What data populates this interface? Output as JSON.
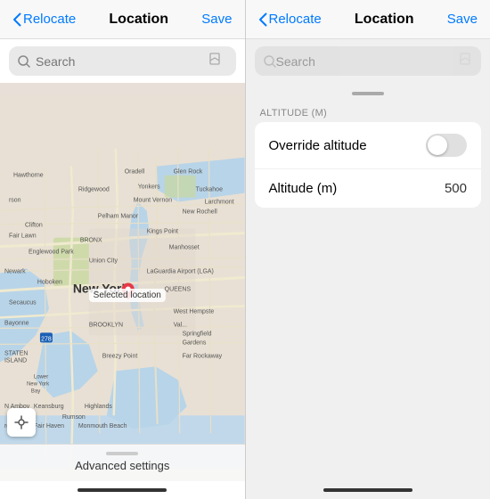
{
  "left": {
    "nav": {
      "back_label": "Relocate",
      "title": "Location",
      "save_label": "Save"
    },
    "search": {
      "placeholder": "Search",
      "bookmark_icon": "bookmark-icon"
    },
    "map": {
      "selected_location_label": "Selected location",
      "city_label": "New York"
    },
    "advanced": {
      "drag_hint": "drag-handle",
      "label": "Advanced settings"
    }
  },
  "right": {
    "nav": {
      "back_label": "Relocate",
      "title": "Location",
      "save_label": "Save"
    },
    "search": {
      "placeholder": "Search"
    },
    "altitude_section": {
      "header": "ALTITUDE (M)",
      "override_label": "Override altitude",
      "altitude_label": "Altitude (m)",
      "altitude_value": "500"
    }
  }
}
